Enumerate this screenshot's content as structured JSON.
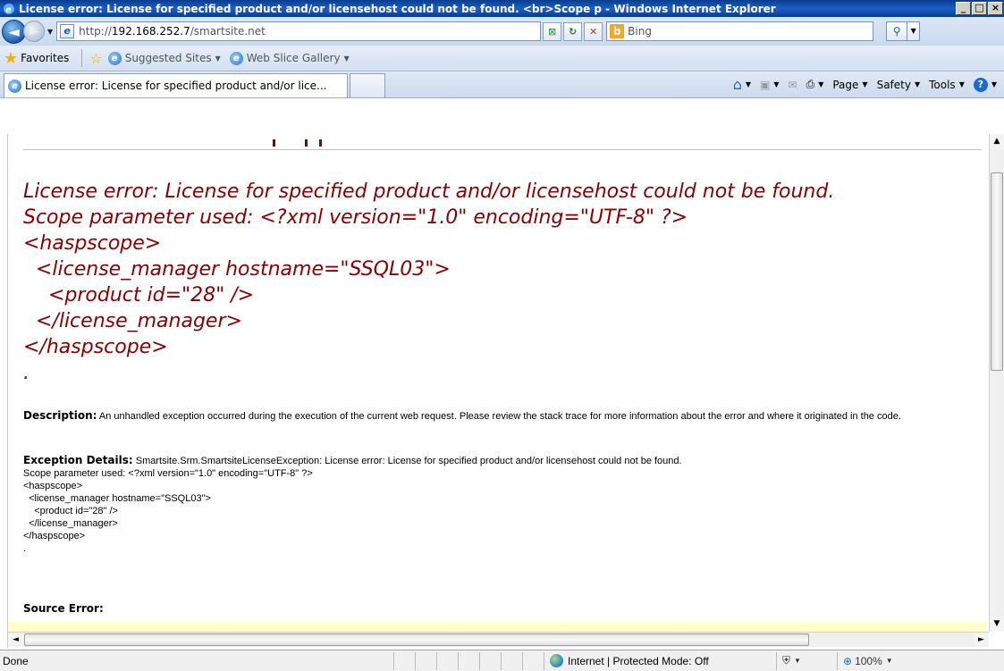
{
  "window": {
    "title": "License error: License for specified product and/or licensehost could not be found. <br>Scope p - Windows Internet Explorer",
    "minimize_glyph": "_",
    "maximize_glyph": "□",
    "close_glyph": "×"
  },
  "navbar": {
    "url_prefix": "http://",
    "url_host": "192.168.252.7",
    "url_path": "/smartsite.net",
    "search_placeholder": "Bing"
  },
  "favorites": {
    "label": "Favorites",
    "items": [
      {
        "label": "Suggested Sites"
      },
      {
        "label": "Web Slice Gallery"
      }
    ]
  },
  "tabs": {
    "active_label": "License error: License for specified product and/or lice..."
  },
  "toolbar": {
    "page_label": "Page",
    "safety_label": "Safety",
    "tools_label": "Tools",
    "help_glyph": "?"
  },
  "content": {
    "big_error": "License error: License for specified product and/or licensehost could not be found.\nScope parameter used: <?xml version=\"1.0\" encoding=\"UTF-8\" ?>\n<haspscope>\n  <license_manager hostname=\"SSQL03\">\n    <product id=\"28\" />\n  </license_manager>\n</haspscope>\n.",
    "description_label": "Description:",
    "description_text": " An unhandled exception occurred during the execution of the current web request. Please review the stack trace for more information about the error and where it originated in the code.",
    "exception_label": "Exception Details:",
    "exception_text": " Smartsite.Srm.SmartsiteLicenseException: License error: License for specified product and/or licensehost could not be found.\nScope parameter used: <?xml version=\"1.0\" encoding=\"UTF-8\" ?>\n<haspscope>\n  <license_manager hostname=\"SSQL03\">\n    <product id=\"28\" />\n  </license_manager>\n</haspscope>\n.",
    "source_error_label": "Source Error:"
  },
  "statusbar": {
    "status_text": "Done",
    "zone_text": "Internet | Protected Mode: Off",
    "zoom_text": "100%"
  }
}
